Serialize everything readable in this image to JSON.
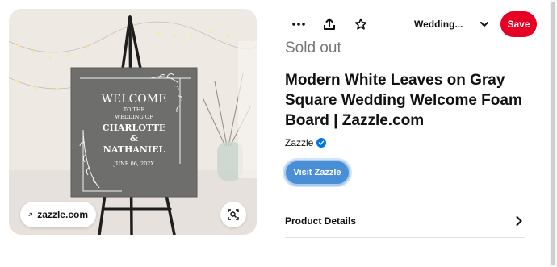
{
  "image": {
    "sign": {
      "welcome": "WELCOME",
      "to_the": "TO THE",
      "wedding_of": "WEDDING OF",
      "name1": "CHARLOTTE",
      "amp": "&",
      "name2": "NATHANIEL",
      "date": "JUNE 06, 202X"
    },
    "source_pill_label": "zazzle.com",
    "source_pill_icon": "arrow-up-right-icon",
    "lens_icon": "visual-search-icon"
  },
  "toolbar": {
    "more_icon": "ellipsis-icon",
    "share_icon": "share-upload-icon",
    "favorite_icon": "star-icon",
    "board_label": "Wedding...",
    "board_icon": "chevron-down-icon",
    "save_label": "Save"
  },
  "product": {
    "status": "Sold out",
    "title": "Modern White Leaves on Gray Square Wedding Welcome Foam Board | Zazzle.com",
    "source_name": "Zazzle",
    "visit_label": "Visit Zazzle",
    "details_label": "Product Details"
  },
  "colors": {
    "save": "#e60023",
    "visit": "#4a8fd6",
    "verified": "#0074e8",
    "sign_board": "#6e6e6c"
  }
}
